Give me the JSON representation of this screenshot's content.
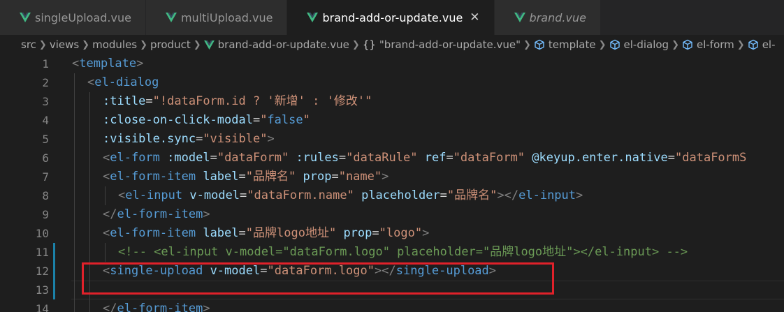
{
  "tabs": [
    {
      "label": "singleUpload.vue",
      "active": false,
      "italic": false
    },
    {
      "label": "multiUpload.vue",
      "active": false,
      "italic": false
    },
    {
      "label": "brand-add-or-update.vue",
      "active": true,
      "italic": false,
      "close": "✕"
    },
    {
      "label": "brand.vue",
      "active": false,
      "italic": true
    }
  ],
  "breadcrumb": {
    "segments": [
      "src",
      "views",
      "modules",
      "product"
    ],
    "file": "brand-add-or-update.vue",
    "braces": "{}",
    "component": "\"brand-add-or-update.vue\"",
    "symbols": [
      "template",
      "el-dialog",
      "el-form",
      "el-"
    ]
  },
  "lines": [
    {
      "n": "1",
      "indent": 0,
      "tokens": [
        [
          "p",
          "<"
        ],
        [
          "t",
          "template"
        ],
        [
          "p",
          ">"
        ]
      ]
    },
    {
      "n": "2",
      "indent": 1,
      "tokens": [
        [
          "p",
          "<"
        ],
        [
          "t",
          "el-dialog"
        ]
      ]
    },
    {
      "n": "3",
      "indent": 2,
      "tokens": [
        [
          "a",
          ":title"
        ],
        [
          "x",
          "="
        ],
        [
          "s",
          "\"!dataForm.id ? '新增' : '修改'\""
        ]
      ]
    },
    {
      "n": "4",
      "indent": 2,
      "tokens": [
        [
          "a",
          ":close-on-click-modal"
        ],
        [
          "x",
          "="
        ],
        [
          "s",
          "\""
        ],
        [
          "t",
          "false"
        ],
        [
          "s",
          "\""
        ]
      ]
    },
    {
      "n": "5",
      "indent": 2,
      "tokens": [
        [
          "a",
          ":visible.sync"
        ],
        [
          "x",
          "="
        ],
        [
          "s",
          "\"visible\""
        ],
        [
          "p",
          ">"
        ]
      ]
    },
    {
      "n": "6",
      "indent": 2,
      "tokens": [
        [
          "p",
          "<"
        ],
        [
          "t",
          "el-form"
        ],
        [
          "x",
          " "
        ],
        [
          "a",
          ":model"
        ],
        [
          "x",
          "="
        ],
        [
          "s",
          "\"dataForm\""
        ],
        [
          "x",
          " "
        ],
        [
          "a",
          ":rules"
        ],
        [
          "x",
          "="
        ],
        [
          "s",
          "\"dataRule\""
        ],
        [
          "x",
          " "
        ],
        [
          "a",
          "ref"
        ],
        [
          "x",
          "="
        ],
        [
          "s",
          "\"dataForm\""
        ],
        [
          "x",
          " "
        ],
        [
          "a",
          "@keyup.enter.native"
        ],
        [
          "x",
          "="
        ],
        [
          "s",
          "\"dataFormS"
        ]
      ]
    },
    {
      "n": "7",
      "indent": 2,
      "tokens": [
        [
          "p",
          "<"
        ],
        [
          "t",
          "el-form-item"
        ],
        [
          "x",
          " "
        ],
        [
          "a",
          "label"
        ],
        [
          "x",
          "="
        ],
        [
          "s",
          "\"品牌名\""
        ],
        [
          "x",
          " "
        ],
        [
          "a",
          "prop"
        ],
        [
          "x",
          "="
        ],
        [
          "s",
          "\"name\""
        ],
        [
          "p",
          ">"
        ]
      ]
    },
    {
      "n": "8",
      "indent": 3,
      "tokens": [
        [
          "p",
          "<"
        ],
        [
          "t",
          "el-input"
        ],
        [
          "x",
          " "
        ],
        [
          "a",
          "v-model"
        ],
        [
          "x",
          "="
        ],
        [
          "s",
          "\"dataForm.name\""
        ],
        [
          "x",
          " "
        ],
        [
          "a",
          "placeholder"
        ],
        [
          "x",
          "="
        ],
        [
          "s",
          "\"品牌名\""
        ],
        [
          "p",
          "></"
        ],
        [
          "t",
          "el-input"
        ],
        [
          "p",
          ">"
        ]
      ]
    },
    {
      "n": "9",
      "indent": 2,
      "tokens": [
        [
          "p",
          "</"
        ],
        [
          "t",
          "el-form-item"
        ],
        [
          "p",
          ">"
        ]
      ]
    },
    {
      "n": "10",
      "indent": 2,
      "tokens": [
        [
          "p",
          "<"
        ],
        [
          "t",
          "el-form-item"
        ],
        [
          "x",
          " "
        ],
        [
          "a",
          "label"
        ],
        [
          "x",
          "="
        ],
        [
          "s",
          "\"品牌logo地址\""
        ],
        [
          "x",
          " "
        ],
        [
          "a",
          "prop"
        ],
        [
          "x",
          "="
        ],
        [
          "s",
          "\"logo\""
        ],
        [
          "p",
          ">"
        ]
      ]
    },
    {
      "n": "11",
      "indent": 3,
      "tokens": [
        [
          "c",
          "<!-- <el-input v-model=\"dataForm.logo\" placeholder=\"品牌logo地址\"></el-input> -->"
        ]
      ]
    },
    {
      "n": "12",
      "indent": 2,
      "tokens": [
        [
          "p",
          "<"
        ],
        [
          "t",
          "single-upload"
        ],
        [
          "x",
          " "
        ],
        [
          "a",
          "v-model"
        ],
        [
          "x",
          "="
        ],
        [
          "s",
          "\"dataForm.logo\""
        ],
        [
          "p",
          "></"
        ],
        [
          "t",
          "single-upload"
        ],
        [
          "p",
          ">"
        ]
      ]
    },
    {
      "n": "13",
      "indent": 2,
      "tokens": []
    },
    {
      "n": "14",
      "indent": 2,
      "tokens": [
        [
          "p",
          "</"
        ],
        [
          "t",
          "el-form-item"
        ],
        [
          "p",
          ">"
        ]
      ]
    }
  ],
  "colors": {
    "accent_vue": "#42b883",
    "highlight_box": "#e0212a",
    "modified_gutter": "#1b81a8"
  }
}
